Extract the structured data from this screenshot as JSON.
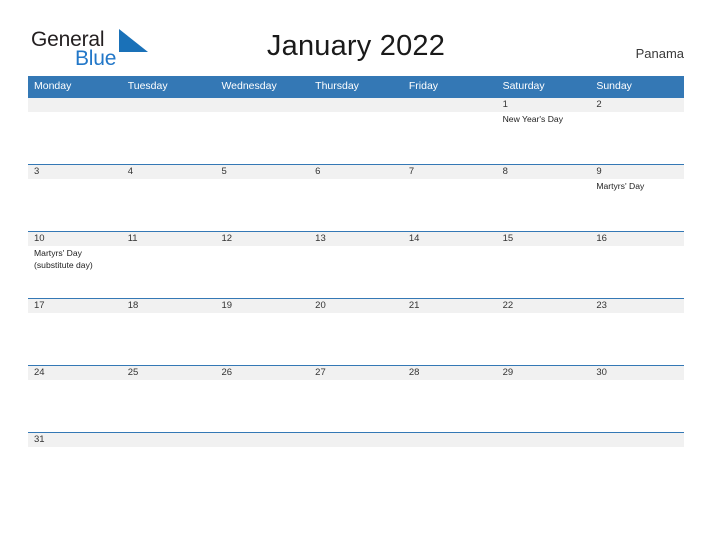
{
  "brand": {
    "name_part1": "General",
    "name_part2": "Blue",
    "flag_icon": "blue-flag-triangle-icon",
    "color_dark": "#231f20",
    "color_blue": "#2277c8"
  },
  "header": {
    "title": "January 2022",
    "region": "Panama"
  },
  "colors": {
    "header_blue": "#3478b5",
    "date_band_gray": "#f1f1f1",
    "rule_blue": "#3478b5",
    "text_dark": "#1d1d1d"
  },
  "calendar": {
    "month": "January",
    "year": "2022",
    "weekday_headers": [
      "Monday",
      "Tuesday",
      "Wednesday",
      "Thursday",
      "Friday",
      "Saturday",
      "Sunday"
    ],
    "weeks": [
      {
        "days": [
          {
            "date": "",
            "event": ""
          },
          {
            "date": "",
            "event": ""
          },
          {
            "date": "",
            "event": ""
          },
          {
            "date": "",
            "event": ""
          },
          {
            "date": "",
            "event": ""
          },
          {
            "date": "1",
            "event": "New Year's Day"
          },
          {
            "date": "2",
            "event": ""
          }
        ]
      },
      {
        "days": [
          {
            "date": "3",
            "event": ""
          },
          {
            "date": "4",
            "event": ""
          },
          {
            "date": "5",
            "event": ""
          },
          {
            "date": "6",
            "event": ""
          },
          {
            "date": "7",
            "event": ""
          },
          {
            "date": "8",
            "event": ""
          },
          {
            "date": "9",
            "event": "Martyrs' Day"
          }
        ]
      },
      {
        "days": [
          {
            "date": "10",
            "event": "Martyrs' Day (substitute day)"
          },
          {
            "date": "11",
            "event": ""
          },
          {
            "date": "12",
            "event": ""
          },
          {
            "date": "13",
            "event": ""
          },
          {
            "date": "14",
            "event": ""
          },
          {
            "date": "15",
            "event": ""
          },
          {
            "date": "16",
            "event": ""
          }
        ]
      },
      {
        "days": [
          {
            "date": "17",
            "event": ""
          },
          {
            "date": "18",
            "event": ""
          },
          {
            "date": "19",
            "event": ""
          },
          {
            "date": "20",
            "event": ""
          },
          {
            "date": "21",
            "event": ""
          },
          {
            "date": "22",
            "event": ""
          },
          {
            "date": "23",
            "event": ""
          }
        ]
      },
      {
        "days": [
          {
            "date": "24",
            "event": ""
          },
          {
            "date": "25",
            "event": ""
          },
          {
            "date": "26",
            "event": ""
          },
          {
            "date": "27",
            "event": ""
          },
          {
            "date": "28",
            "event": ""
          },
          {
            "date": "29",
            "event": ""
          },
          {
            "date": "30",
            "event": ""
          }
        ]
      },
      {
        "days": [
          {
            "date": "31",
            "event": ""
          },
          {
            "date": "",
            "event": ""
          },
          {
            "date": "",
            "event": ""
          },
          {
            "date": "",
            "event": ""
          },
          {
            "date": "",
            "event": ""
          },
          {
            "date": "",
            "event": ""
          },
          {
            "date": "",
            "event": ""
          }
        ]
      }
    ]
  }
}
